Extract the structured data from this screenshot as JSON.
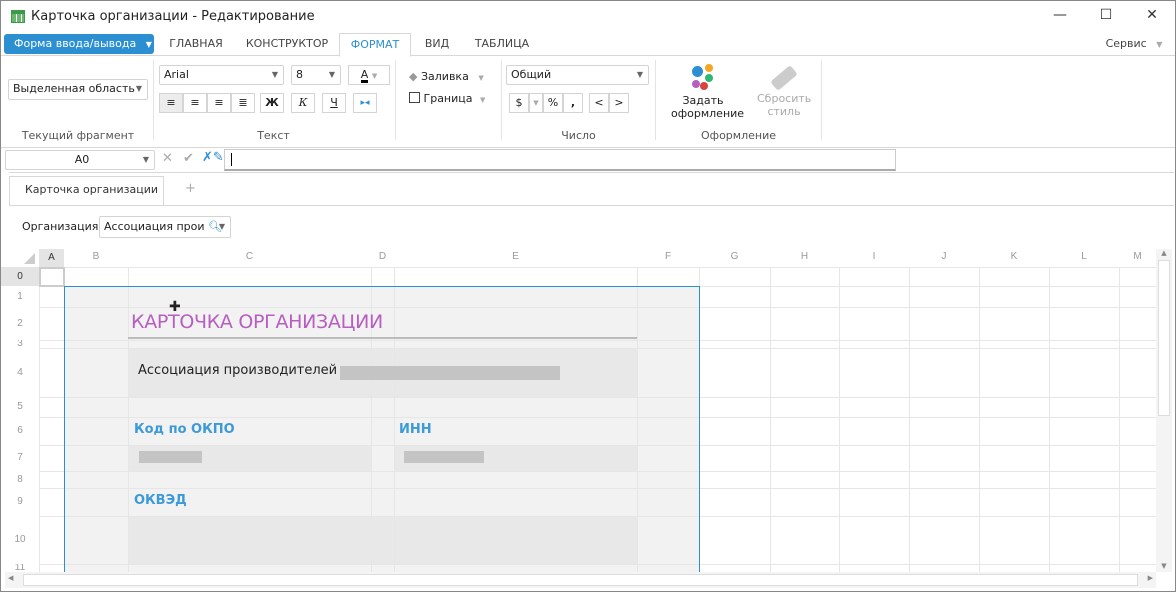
{
  "window": {
    "title": "Карточка организации - Редактирование",
    "minimize": "—",
    "maximize": "☐",
    "close": "✕"
  },
  "menu": {
    "file_button": "Форма ввода/вывода",
    "tabs": [
      "ГЛАВНАЯ",
      "КОНСТРУКТОР",
      "ФОРМАТ",
      "ВИД",
      "ТАБЛИЦА"
    ],
    "active_tab": "ФОРМАТ",
    "service": "Сервис"
  },
  "ribbon": {
    "fragment": {
      "value": "Выделенная область",
      "group": "Текущий фрагмент"
    },
    "text": {
      "font": "Arial",
      "size": "8",
      "bold": "Ж",
      "italic": "К",
      "underline": "Ч",
      "group": "Текст"
    },
    "fill": "Заливка",
    "border": "Граница",
    "number": {
      "format": "Общий",
      "currency": "$",
      "percent": "%",
      "thousands": ",",
      "dec_less": "<",
      "dec_more": ">",
      "group": "Число"
    },
    "style": {
      "set": "Задать оформление",
      "reset": "Сбросить стиль",
      "group": "Оформление"
    }
  },
  "formula_bar": {
    "cell_ref": "A0",
    "value": ""
  },
  "sheet_tabs": {
    "tabs": [
      "Карточка организации"
    ],
    "add": "+"
  },
  "filter": {
    "label": "Организация:",
    "value": "Ассоциация прои"
  },
  "grid": {
    "columns": [
      "A",
      "B",
      "C",
      "D",
      "E",
      "F",
      "G",
      "H",
      "I",
      "J",
      "K",
      "L",
      "M"
    ],
    "rows": [
      "0",
      "1",
      "2",
      "3",
      "4",
      "5",
      "6",
      "7",
      "8",
      "9",
      "10",
      "11"
    ],
    "title": "КАРТОЧКА ОРГАНИЗАЦИИ",
    "org_name": "Ассоциация производителей",
    "okpo_label": "Код по ОКПО",
    "inn_label": "ИНН",
    "okved_label": "ОКВЭД"
  },
  "colors": {
    "accent": "#2b8fd1",
    "title": "#b65fc0",
    "label": "#3c9ad6",
    "selection_fill": "#f2f2f2",
    "field_fill": "#e8e8e8"
  }
}
